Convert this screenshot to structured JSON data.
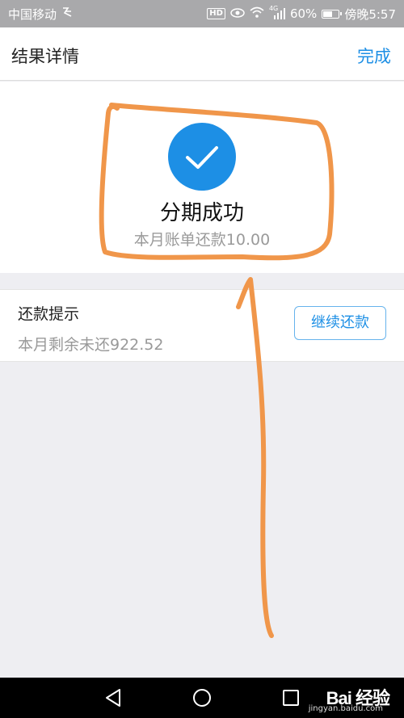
{
  "status_bar": {
    "carrier": "中国移动",
    "network_type": "4G",
    "battery": "60%",
    "battery_level": 0.6,
    "time": "傍晚5:57",
    "hd_badge": "HD"
  },
  "navbar": {
    "title": "结果详情",
    "done_label": "完成"
  },
  "result": {
    "icon": "check-icon",
    "title": "分期成功",
    "subtitle": "本月账单还款10.00"
  },
  "tip": {
    "title": "还款提示",
    "description": "本月剩余未还922.52",
    "button_label": "继续还款"
  },
  "annotation": {
    "color": "#f0964a"
  },
  "system_nav": {
    "back_icon": "back-triangle-icon",
    "home_icon": "home-circle-icon",
    "recents_icon": "recents-square-icon"
  },
  "watermark": {
    "logo": "Bai 经验",
    "url": "jingyan.baidu.com"
  },
  "colors": {
    "accent": "#1d8fe5",
    "annotation": "#f0964a"
  }
}
